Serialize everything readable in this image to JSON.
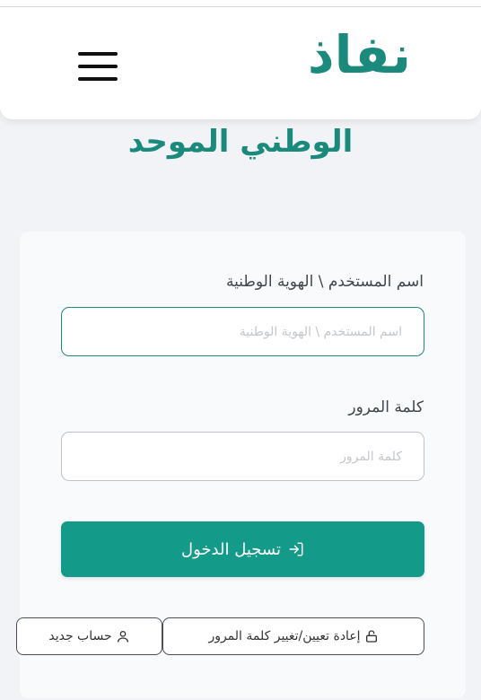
{
  "header": {
    "logo_text": "نفاذ",
    "menu_icon": "hamburger-menu-icon",
    "subtitle": "الوطني الموحد"
  },
  "form": {
    "username_label": "اسم المستخدم \\ الهوية الوطنية",
    "username_placeholder": "اسم المستخدم \\ الهوية الوطنية",
    "username_value": "",
    "password_label": "كلمة المرور",
    "password_placeholder": "كلمة المرور",
    "password_value": "",
    "login_label": "تسجيل الدخول",
    "login_icon": "sign-in-icon",
    "reset_label": "إعادة تعيين/تغيير كلمة المرور",
    "reset_icon": "lock-icon",
    "new_account_label": "حساب جديد",
    "new_account_icon": "user-icon"
  },
  "colors": {
    "brand": "#1b8a7d",
    "button": "#149a88",
    "background": "#f1f3f6"
  }
}
